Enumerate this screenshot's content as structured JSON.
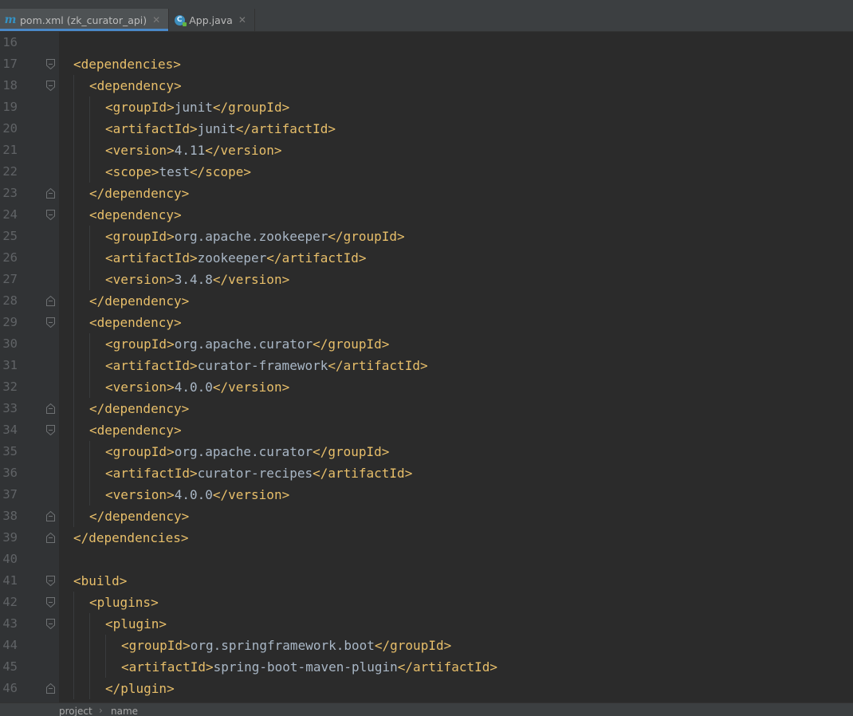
{
  "tabs": [
    {
      "label": "pom.xml (zk_curator_api)",
      "icon": "maven-icon",
      "active": true
    },
    {
      "label": "App.java",
      "icon": "java-class-icon",
      "active": false
    }
  ],
  "breadcrumb": {
    "items": [
      "project",
      "name"
    ],
    "separator": "›"
  },
  "editor": {
    "lines": [
      {
        "num": "16",
        "indent": 0,
        "parts": [],
        "fold": ""
      },
      {
        "num": "17",
        "indent": 0,
        "parts": [
          {
            "t": "tag",
            "v": "<dependencies>"
          }
        ],
        "fold": "open"
      },
      {
        "num": "18",
        "indent": 1,
        "parts": [
          {
            "t": "tag",
            "v": "<dependency>"
          }
        ],
        "fold": "open"
      },
      {
        "num": "19",
        "indent": 2,
        "parts": [
          {
            "t": "tag",
            "v": "<groupId>"
          },
          {
            "t": "txt",
            "v": "junit"
          },
          {
            "t": "tag",
            "v": "</groupId>"
          }
        ],
        "fold": ""
      },
      {
        "num": "20",
        "indent": 2,
        "parts": [
          {
            "t": "tag",
            "v": "<artifactId>"
          },
          {
            "t": "txt",
            "v": "junit"
          },
          {
            "t": "tag",
            "v": "</artifactId>"
          }
        ],
        "fold": ""
      },
      {
        "num": "21",
        "indent": 2,
        "parts": [
          {
            "t": "tag",
            "v": "<version>"
          },
          {
            "t": "txt",
            "v": "4.11"
          },
          {
            "t": "tag",
            "v": "</version>"
          }
        ],
        "fold": ""
      },
      {
        "num": "22",
        "indent": 2,
        "parts": [
          {
            "t": "tag",
            "v": "<scope>"
          },
          {
            "t": "txt",
            "v": "test"
          },
          {
            "t": "tag",
            "v": "</scope>"
          }
        ],
        "fold": ""
      },
      {
        "num": "23",
        "indent": 1,
        "parts": [
          {
            "t": "tag",
            "v": "</dependency>"
          }
        ],
        "fold": "close"
      },
      {
        "num": "24",
        "indent": 1,
        "parts": [
          {
            "t": "tag",
            "v": "<dependency>"
          }
        ],
        "fold": "open"
      },
      {
        "num": "25",
        "indent": 2,
        "parts": [
          {
            "t": "tag",
            "v": "<groupId>"
          },
          {
            "t": "txt",
            "v": "org.apache.zookeeper"
          },
          {
            "t": "tag",
            "v": "</groupId>"
          }
        ],
        "fold": ""
      },
      {
        "num": "26",
        "indent": 2,
        "parts": [
          {
            "t": "tag",
            "v": "<artifactId>"
          },
          {
            "t": "txt",
            "v": "zookeeper"
          },
          {
            "t": "tag",
            "v": "</artifactId>"
          }
        ],
        "fold": ""
      },
      {
        "num": "27",
        "indent": 2,
        "parts": [
          {
            "t": "tag",
            "v": "<version>"
          },
          {
            "t": "txt",
            "v": "3.4.8"
          },
          {
            "t": "tag",
            "v": "</version>"
          }
        ],
        "fold": ""
      },
      {
        "num": "28",
        "indent": 1,
        "parts": [
          {
            "t": "tag",
            "v": "</dependency>"
          }
        ],
        "fold": "close"
      },
      {
        "num": "29",
        "indent": 1,
        "parts": [
          {
            "t": "tag",
            "v": "<dependency>"
          }
        ],
        "fold": "open"
      },
      {
        "num": "30",
        "indent": 2,
        "parts": [
          {
            "t": "tag",
            "v": "<groupId>"
          },
          {
            "t": "txt",
            "v": "org.apache.curator"
          },
          {
            "t": "tag",
            "v": "</groupId>"
          }
        ],
        "fold": ""
      },
      {
        "num": "31",
        "indent": 2,
        "parts": [
          {
            "t": "tag",
            "v": "<artifactId>"
          },
          {
            "t": "txt",
            "v": "curator-framework"
          },
          {
            "t": "tag",
            "v": "</artifactId>"
          }
        ],
        "fold": ""
      },
      {
        "num": "32",
        "indent": 2,
        "parts": [
          {
            "t": "tag",
            "v": "<version>"
          },
          {
            "t": "txt",
            "v": "4.0.0"
          },
          {
            "t": "tag",
            "v": "</version>"
          }
        ],
        "fold": ""
      },
      {
        "num": "33",
        "indent": 1,
        "parts": [
          {
            "t": "tag",
            "v": "</dependency>"
          }
        ],
        "fold": "close"
      },
      {
        "num": "34",
        "indent": 1,
        "parts": [
          {
            "t": "tag",
            "v": "<dependency>"
          }
        ],
        "fold": "open"
      },
      {
        "num": "35",
        "indent": 2,
        "parts": [
          {
            "t": "tag",
            "v": "<groupId>"
          },
          {
            "t": "txt",
            "v": "org.apache.curator"
          },
          {
            "t": "tag",
            "v": "</groupId>"
          }
        ],
        "fold": ""
      },
      {
        "num": "36",
        "indent": 2,
        "parts": [
          {
            "t": "tag",
            "v": "<artifactId>"
          },
          {
            "t": "txt",
            "v": "curator-recipes"
          },
          {
            "t": "tag",
            "v": "</artifactId>"
          }
        ],
        "fold": ""
      },
      {
        "num": "37",
        "indent": 2,
        "parts": [
          {
            "t": "tag",
            "v": "<version>"
          },
          {
            "t": "txt",
            "v": "4.0.0"
          },
          {
            "t": "tag",
            "v": "</version>"
          }
        ],
        "fold": ""
      },
      {
        "num": "38",
        "indent": 1,
        "parts": [
          {
            "t": "tag",
            "v": "</dependency>"
          }
        ],
        "fold": "close"
      },
      {
        "num": "39",
        "indent": 0,
        "parts": [
          {
            "t": "tag",
            "v": "</dependencies>"
          }
        ],
        "fold": "close"
      },
      {
        "num": "40",
        "indent": 0,
        "parts": [],
        "fold": ""
      },
      {
        "num": "41",
        "indent": 0,
        "parts": [
          {
            "t": "tag",
            "v": "<build>"
          }
        ],
        "fold": "open"
      },
      {
        "num": "42",
        "indent": 1,
        "parts": [
          {
            "t": "tag",
            "v": "<plugins>"
          }
        ],
        "fold": "open"
      },
      {
        "num": "43",
        "indent": 2,
        "parts": [
          {
            "t": "tag",
            "v": "<plugin>"
          }
        ],
        "fold": "open"
      },
      {
        "num": "44",
        "indent": 3,
        "parts": [
          {
            "t": "tag",
            "v": "<groupId>"
          },
          {
            "t": "txt",
            "v": "org.springframework.boot"
          },
          {
            "t": "tag",
            "v": "</groupId>"
          }
        ],
        "fold": ""
      },
      {
        "num": "45",
        "indent": 3,
        "parts": [
          {
            "t": "tag",
            "v": "<artifactId>"
          },
          {
            "t": "txt",
            "v": "spring-boot-maven-plugin"
          },
          {
            "t": "tag",
            "v": "</artifactId>"
          }
        ],
        "fold": ""
      },
      {
        "num": "46",
        "indent": 2,
        "parts": [
          {
            "t": "tag",
            "v": "</plugin>"
          }
        ],
        "fold": "close"
      }
    ]
  },
  "colors": {
    "background": "#2b2b2b",
    "gutter": "#313335",
    "tag": "#e8bf6a",
    "text": "#a9b7c6",
    "line_number": "#606366",
    "tab_accent": "#4a88c7"
  }
}
